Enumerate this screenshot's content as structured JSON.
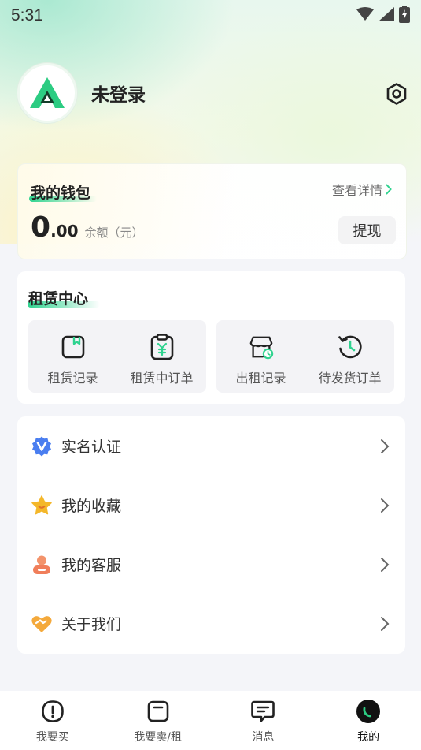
{
  "status_bar": {
    "time": "5:31"
  },
  "profile": {
    "username": "未登录"
  },
  "wallet": {
    "title": "我的钱包",
    "detail_link": "查看详情",
    "balance_int": "0",
    "balance_dec": ".00",
    "balance_label": "余额（元）",
    "withdraw_label": "提现"
  },
  "rental_center": {
    "title": "租赁中心",
    "items": [
      {
        "label": "租赁记录",
        "icon": "bookmark-icon"
      },
      {
        "label": "租赁中订单",
        "icon": "yuan-clipboard-icon"
      },
      {
        "label": "出租记录",
        "icon": "store-clock-icon"
      },
      {
        "label": "待发货订单",
        "icon": "history-icon"
      }
    ]
  },
  "menu": {
    "items": [
      {
        "label": "实名认证",
        "icon": "verified-badge-icon",
        "color": "#4a7ef0"
      },
      {
        "label": "我的收藏",
        "icon": "star-face-icon",
        "color": "#f4b72a"
      },
      {
        "label": "我的客服",
        "icon": "customer-service-icon",
        "color": "#f07e5a"
      },
      {
        "label": "关于我们",
        "icon": "handshake-heart-icon",
        "color": "#f4a93b"
      }
    ]
  },
  "tabbar": {
    "items": [
      {
        "label": "我要买",
        "icon": "info-circle-icon"
      },
      {
        "label": "我要卖/租",
        "icon": "square-minus-icon"
      },
      {
        "label": "消息",
        "icon": "message-icon"
      },
      {
        "label": "我的",
        "icon": "profile-dark-icon",
        "active": true
      }
    ]
  },
  "colors": {
    "accent": "#2fd38f",
    "brand_green": "#2ccc82",
    "background": "#f4f5f9"
  }
}
